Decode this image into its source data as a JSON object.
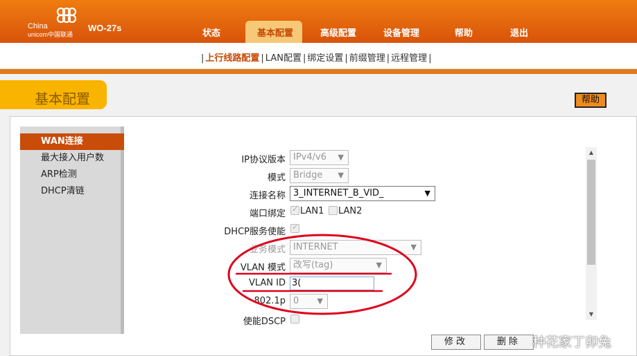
{
  "header": {
    "logo_line1": "China",
    "logo_line2": "unicom中国联通",
    "model": "WO-27s",
    "nav": [
      "状态",
      "基本配置",
      "高级配置",
      "设备管理",
      "帮助",
      "退出"
    ],
    "active_nav": "基本配置"
  },
  "subnav": {
    "items": [
      "上行线路配置",
      "LAN配置",
      "绑定设置",
      "前缀管理",
      "远程管理"
    ],
    "active": "上行线路配置"
  },
  "page": {
    "title": "基本配置",
    "help_label": "帮助"
  },
  "sidebar": {
    "items": [
      "WAN连接",
      "最大接入用户数",
      "ARP检测",
      "DHCP清链"
    ],
    "active": "WAN连接"
  },
  "form": {
    "ip_version": {
      "label": "IP协议版本",
      "value": "IPv4/v6"
    },
    "mode": {
      "label": "模式",
      "value": "Bridge"
    },
    "connection_name": {
      "label": "连接名称",
      "value": "3_INTERNET_B_VID_"
    },
    "port_binding": {
      "label": "端口绑定",
      "lan1": "LAN1",
      "lan2": "LAN2"
    },
    "dhcp_service": {
      "label": "DHCP服务使能"
    },
    "service_mode": {
      "label": "业务模式",
      "value": "INTERNET"
    },
    "vlan_mode": {
      "label": "VLAN 模式",
      "value": "改写(tag)"
    },
    "vlan_id": {
      "label": "VLAN ID",
      "value": "3("
    },
    "priority": {
      "label": "802.1p",
      "value": "0"
    },
    "dscp": {
      "label": "使能DSCP"
    }
  },
  "buttons": {
    "modify": "修改",
    "delete": "删除"
  },
  "watermark": "种花家丁卯兔",
  "colors": {
    "header_orange": "#e0600c",
    "active_tab": "#f6c877",
    "sidebar_active": "#c94c08",
    "title_tab": "#f9b400",
    "annotation_red": "#e0001b"
  }
}
